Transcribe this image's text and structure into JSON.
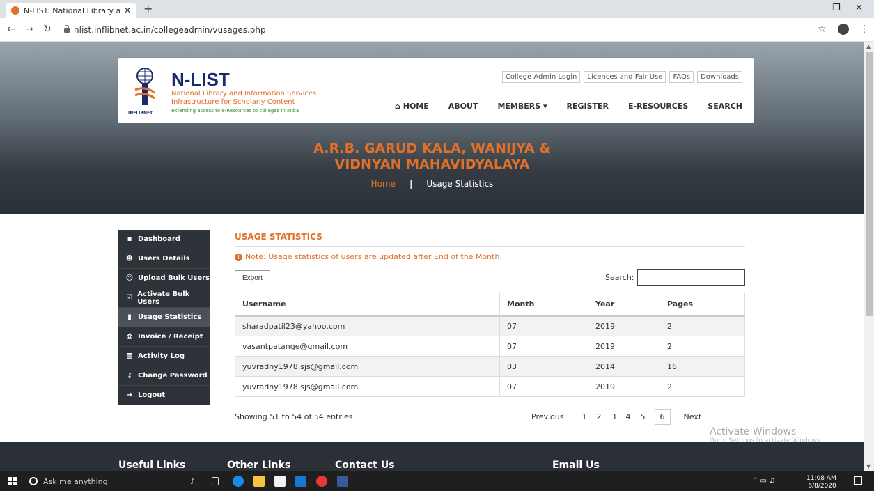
{
  "browser": {
    "tab_title": "N-LIST: National Library and Info",
    "url": "nlist.inflibnet.ac.in/collegeadmin/vusages.php"
  },
  "brand": {
    "name": "N-LIST",
    "line1": "National Library and Information Services",
    "line2": "Infrastructure for Scholarly Content",
    "line3": "extending access to e-Resources to colleges in India",
    "mark_text": "INFLIBNET"
  },
  "toplinks": [
    "College Admin Login",
    "Licences and Fair Use",
    "FAQs",
    "Downloads"
  ],
  "nav": [
    {
      "label": "HOME",
      "icon": "home-icon"
    },
    {
      "label": "ABOUT"
    },
    {
      "label": "MEMBERS"
    },
    {
      "label": "REGISTER"
    },
    {
      "label": "E-RESOURCES"
    },
    {
      "label": "SEARCH"
    }
  ],
  "college": {
    "line1": "A.R.B. GARUD KALA, WANIJYA &",
    "line2": "VIDNYAN MAHAVIDYALAYA"
  },
  "breadcrumb": {
    "home": "Home",
    "current": "Usage Statistics"
  },
  "sidebar": [
    {
      "label": "Dashboard",
      "icon": "dashboard-icon",
      "glyph": "▪"
    },
    {
      "label": "Users Details",
      "icon": "users-icon",
      "glyph": "☻"
    },
    {
      "label": "Upload Bulk Users",
      "icon": "upload-users-icon",
      "glyph": "☺"
    },
    {
      "label": "Activate Bulk Users",
      "icon": "check-square-icon",
      "glyph": "☑"
    },
    {
      "label": "Usage Statistics",
      "icon": "bar-chart-icon",
      "glyph": "▮"
    },
    {
      "label": "Invoice / Receipt",
      "icon": "print-icon",
      "glyph": "⎙"
    },
    {
      "label": "Activity Log",
      "icon": "list-icon",
      "glyph": "≣"
    },
    {
      "label": "Change Password",
      "icon": "key-icon",
      "glyph": "⚷"
    },
    {
      "label": "Logout",
      "icon": "logout-icon",
      "glyph": "➜"
    }
  ],
  "content": {
    "title": "USAGE STATISTICS",
    "note": "Note: Usage statistics of users are updated after End of the Month.",
    "export": "Export",
    "search_label": "Search:",
    "showing": "Showing 51 to 54 of 54 entries"
  },
  "table": {
    "headers": [
      "Username",
      "Month",
      "Year",
      "Pages"
    ],
    "rows": [
      [
        "sharadpatil23@yahoo.com",
        "07",
        "2019",
        "2"
      ],
      [
        "vasantpatange@gmail.com",
        "07",
        "2019",
        "2"
      ],
      [
        "yuvradny1978.sjs@gmail.com",
        "03",
        "2014",
        "16"
      ],
      [
        "yuvradny1978.sjs@gmail.com",
        "07",
        "2019",
        "2"
      ]
    ]
  },
  "pager": {
    "prev": "Previous",
    "pages": [
      "1",
      "2",
      "3",
      "4",
      "5",
      "6"
    ],
    "current": "6",
    "next": "Next"
  },
  "watermark": {
    "line1": "Activate Windows",
    "line2": "Go to Settings to activate Windows."
  },
  "footer": [
    "Useful Links",
    "Other Links",
    "Contact Us",
    "Email Us"
  ],
  "taskbar": {
    "search": "Ask me anything",
    "time": "11:08 AM",
    "date": "6/8/2020"
  },
  "colors": {
    "accent": "#e0702a",
    "sidebar": "#2d3338"
  }
}
